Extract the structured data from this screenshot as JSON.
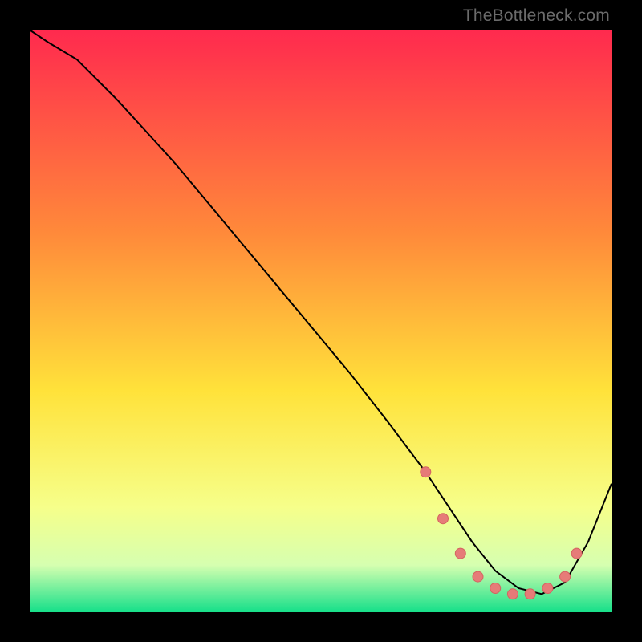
{
  "attribution": "TheBottleneck.com",
  "colors": {
    "gradient_top": "#ff2a4e",
    "gradient_mid1": "#ff8a3a",
    "gradient_mid2": "#ffe23a",
    "gradient_low": "#f6ff8a",
    "gradient_band": "#d6ffb0",
    "gradient_bottom": "#18e08a",
    "curve": "#000000",
    "marker_fill": "#e67b78",
    "marker_stroke": "#d46360"
  },
  "chart_data": {
    "type": "line",
    "title": "",
    "xlabel": "",
    "ylabel": "",
    "xlim": [
      0,
      100
    ],
    "ylim": [
      0,
      100
    ],
    "series": [
      {
        "name": "curve",
        "x": [
          0,
          3,
          8,
          15,
          25,
          35,
          45,
          55,
          62,
          68,
          72,
          76,
          80,
          84,
          88,
          92,
          96,
          100
        ],
        "values": [
          100,
          98,
          95,
          88,
          77,
          65,
          53,
          41,
          32,
          24,
          18,
          12,
          7,
          4,
          3,
          5,
          12,
          22
        ]
      }
    ],
    "markers": {
      "name": "bottleneck-band",
      "x": [
        68,
        71,
        74,
        77,
        80,
        83,
        86,
        89,
        92,
        94
      ],
      "values": [
        24,
        16,
        10,
        6,
        4,
        3,
        3,
        4,
        6,
        10
      ]
    }
  }
}
